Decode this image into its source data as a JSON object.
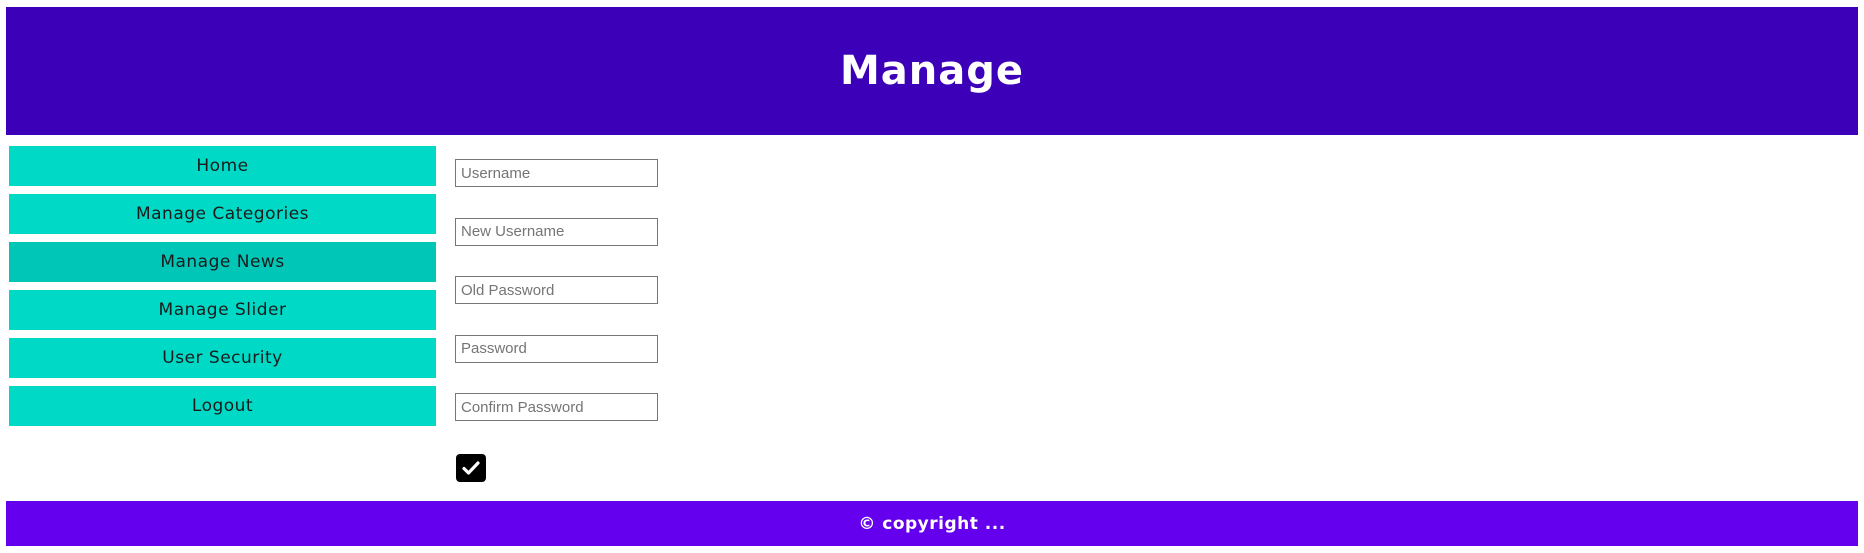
{
  "header": {
    "title": "Manage"
  },
  "sidebar": {
    "items": [
      {
        "label": "Home"
      },
      {
        "label": "Manage Categories"
      },
      {
        "label": "Manage News"
      },
      {
        "label": "Manage Slider"
      },
      {
        "label": "User Security"
      },
      {
        "label": "Logout"
      }
    ]
  },
  "form": {
    "username": {
      "placeholder": "Username",
      "value": ""
    },
    "new_username": {
      "placeholder": "New Username",
      "value": ""
    },
    "old_password": {
      "placeholder": "Old Password",
      "value": ""
    },
    "password": {
      "placeholder": "Password",
      "value": ""
    },
    "confirm_password": {
      "placeholder": "Confirm Password",
      "value": ""
    },
    "submit_icon": "check-icon"
  },
  "footer": {
    "text": "© copyright ..."
  },
  "colors": {
    "header_bg": "#3c00b9",
    "nav_bg": "#00d9c6",
    "nav_active_bg": "#00c6b7",
    "footer_bg": "#6400ee"
  }
}
